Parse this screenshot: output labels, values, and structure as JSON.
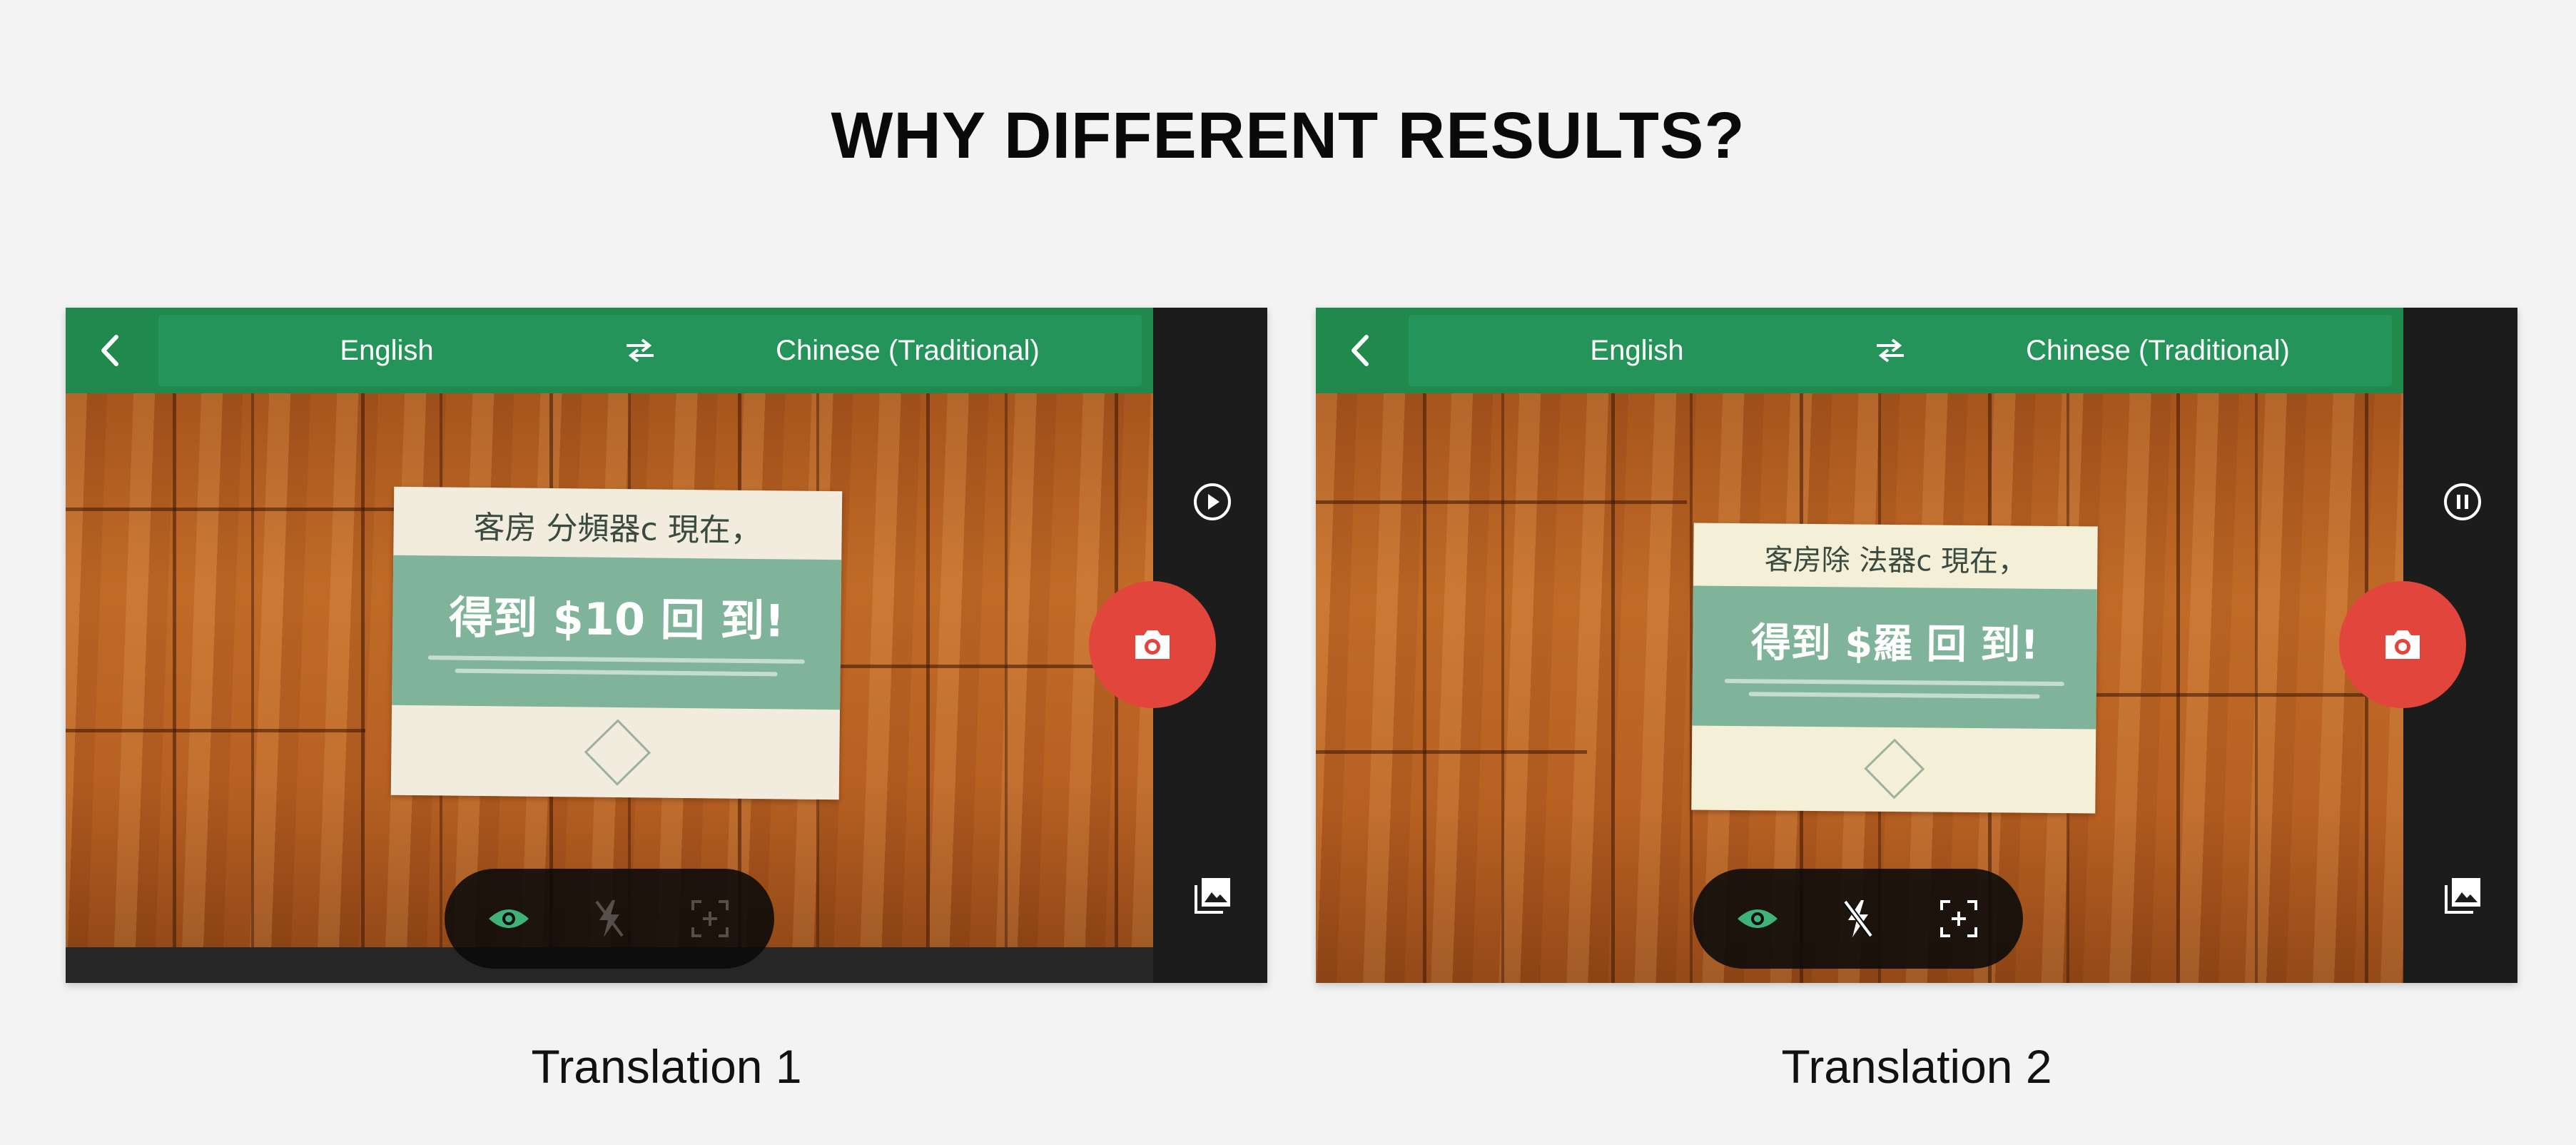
{
  "page": {
    "title": "WHY DIFFERENT RESULTS?"
  },
  "screens": [
    {
      "caption": "Translation 1",
      "source_language": "English",
      "target_language": "Chinese (Traditional)",
      "side_top_icon": "play-icon",
      "sign": {
        "headline": "客房 分頻器c 現在，",
        "offer": "得到 $10 回 到!"
      },
      "toolbar_icons": [
        "eye-icon",
        "flash-off-icon",
        "select-area-icon"
      ],
      "toolbar_dimmed": true
    },
    {
      "caption": "Translation 2",
      "source_language": "English",
      "target_language": "Chinese (Traditional)",
      "side_top_icon": "pause-icon",
      "sign": {
        "headline": "客房除 法器c 現在，",
        "offer": "得到 $羅 回 到!"
      },
      "toolbar_icons": [
        "eye-icon",
        "flash-off-icon",
        "select-area-icon"
      ],
      "toolbar_dimmed": false
    }
  ],
  "colors": {
    "brand_green": "#1f8a4b",
    "shutter_red": "#e2453c",
    "eye_green": "#3fb27a",
    "sidebar": "#1c1c1c"
  }
}
